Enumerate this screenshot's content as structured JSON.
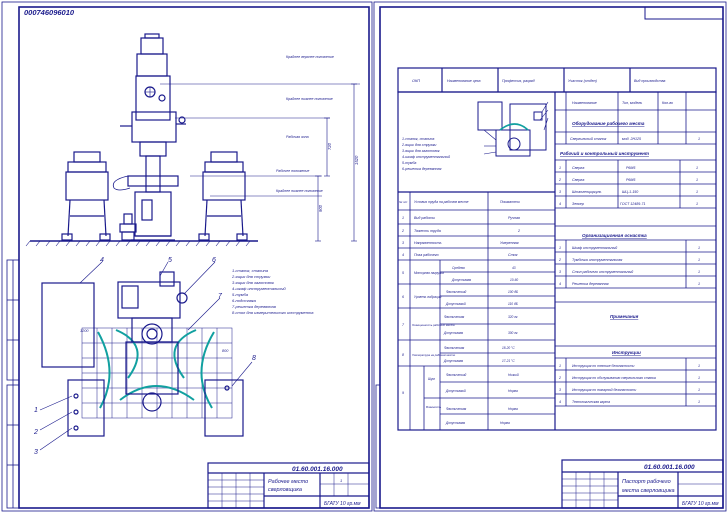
{
  "colors": {
    "line": "#1a1a8c",
    "paper": "#ffffff",
    "grid": "#1a1a8c",
    "hatch": "#11a0a0"
  },
  "left_sheet": {
    "corner_code": "000746096010",
    "doc_code": "01.60.001.16.000",
    "title_line1": "Рабочее место",
    "title_line2": "сверловщика",
    "org": "БГАТУ 10 гр.мм",
    "sheet_no": "1"
  },
  "right_sheet": {
    "doc_code": "01.60.001.16.000",
    "title_line1": "Паспорт рабочего",
    "title_line2": "места сверловщика",
    "org": "БГАТУ 10 гр.мм"
  },
  "header_row": [
    "ОКП",
    "Наименование цеха",
    "Профессия, разряд",
    "Участок (отдел)",
    "Вид производства"
  ],
  "equip_table": {
    "heading": "Оборудование рабочего места",
    "columns": [
      "Наименование",
      "Тип, модель",
      "Кол-во"
    ],
    "rows": [
      [
        "Сверлильный станок",
        "мод. 2Н125",
        "1"
      ]
    ]
  },
  "tools_table": {
    "heading": "Рабочий и контрольный инструмент",
    "rows": [
      [
        "1",
        "Сверла",
        "Р6М5",
        "1"
      ],
      [
        "2",
        "Сверла",
        "Р6М5",
        "1"
      ],
      [
        "3",
        "Штангенциркуль",
        "ШЦ-1-150",
        "1"
      ],
      [
        "4",
        "Зенкер",
        "ГОСТ 12489-71",
        "1"
      ]
    ]
  },
  "org_table": {
    "heading": "Организационная оснастка",
    "rows": [
      [
        "1",
        "Шкаф инструментальный",
        "1"
      ],
      [
        "2",
        "Тумбочка инструментальная",
        "1"
      ],
      [
        "3",
        "Стол рабочего инструментальный",
        "1"
      ],
      [
        "4",
        "Решетка деревянная",
        "1"
      ]
    ]
  },
  "notes_heading": "Примечания",
  "docs_table": {
    "heading": "Инструкции",
    "rows": [
      [
        "1",
        "Инструкция по технике безопасности",
        "1"
      ],
      [
        "2",
        "Инструкция по обслуживанию сверлильного станка",
        "1"
      ],
      [
        "3",
        "Инструкция по пожарной безопасности",
        "1"
      ],
      [
        "4",
        "Технологическая карта",
        "1"
      ]
    ]
  },
  "params": {
    "col_num": "№ п/п",
    "col_name": "Условия труда на рабочем месте",
    "col_value": "Показатели",
    "rows": [
      {
        "n": "1",
        "name": "Вид работы",
        "value": "Ручная"
      },
      {
        "n": "2",
        "name": "Тяжесть труда",
        "value": "2"
      },
      {
        "n": "3",
        "name": "Напряженность",
        "value": "Умеренная"
      },
      {
        "n": "4",
        "name": "Поза рабочего",
        "value": "Стоя"
      },
      {
        "n": "5",
        "name": "Моторная нагрузка",
        "sub": [
          [
            "Средняя",
            "43"
          ],
          [
            "Допустимая",
            "10-60"
          ]
        ]
      },
      {
        "n": "6",
        "name": "Уровень вибрации",
        "sub": [
          [
            "Фактический",
            "100 дБ"
          ],
          [
            "Допустимый",
            "110 дБ"
          ]
        ]
      },
      {
        "n": "7",
        "name": "Освещенность рабочего места",
        "sub": [
          [
            "Фактическая",
            "320 лк"
          ],
          [
            "Допустимая",
            "300 лк"
          ]
        ]
      },
      {
        "n": "8",
        "name": "Температура на рабочем месте",
        "sub": [
          [
            "Фактическая",
            "18-20 °С"
          ],
          [
            "Допустимая",
            "17-21 °С"
          ]
        ]
      },
      {
        "n": "9",
        "name": "Шум",
        "sub": [
          [
            "Фактический",
            "Низкий"
          ],
          [
            "Допустимый",
            "Норма"
          ]
        ]
      },
      {
        "n": "",
        "name": "Влажность",
        "sub": [
          [
            "Фактическая",
            "Норма"
          ],
          [
            "Допустимая",
            "Норма"
          ]
        ]
      }
    ]
  },
  "plan_legend": [
    "1-станок, станина",
    "2-ящик для стружки",
    "3-ящик для заготовок",
    "4-шкаф инструментальный",
    "5-тумба",
    "6-подставка",
    "7-решетка деревянная",
    "8-стол для измерительного инструмента"
  ],
  "passport_legend": [
    "1-станок, станина",
    "2-ящик для стружки",
    "3-ящик для заготовок",
    "4-шкаф инструментальный",
    "5-тумба",
    "6-решетка деревянная"
  ],
  "callouts": [
    "1",
    "2",
    "3",
    "4",
    "5",
    "6",
    "7",
    "8"
  ],
  "elev_labels": [
    "Крайнее верхнее положение",
    "Крайнее нижнее положение",
    "Рабочая зона",
    "Рабочее положение",
    "Крайнее нижнее положение"
  ],
  "dims": [
    "1520",
    "720",
    "900",
    "1200",
    "800"
  ]
}
